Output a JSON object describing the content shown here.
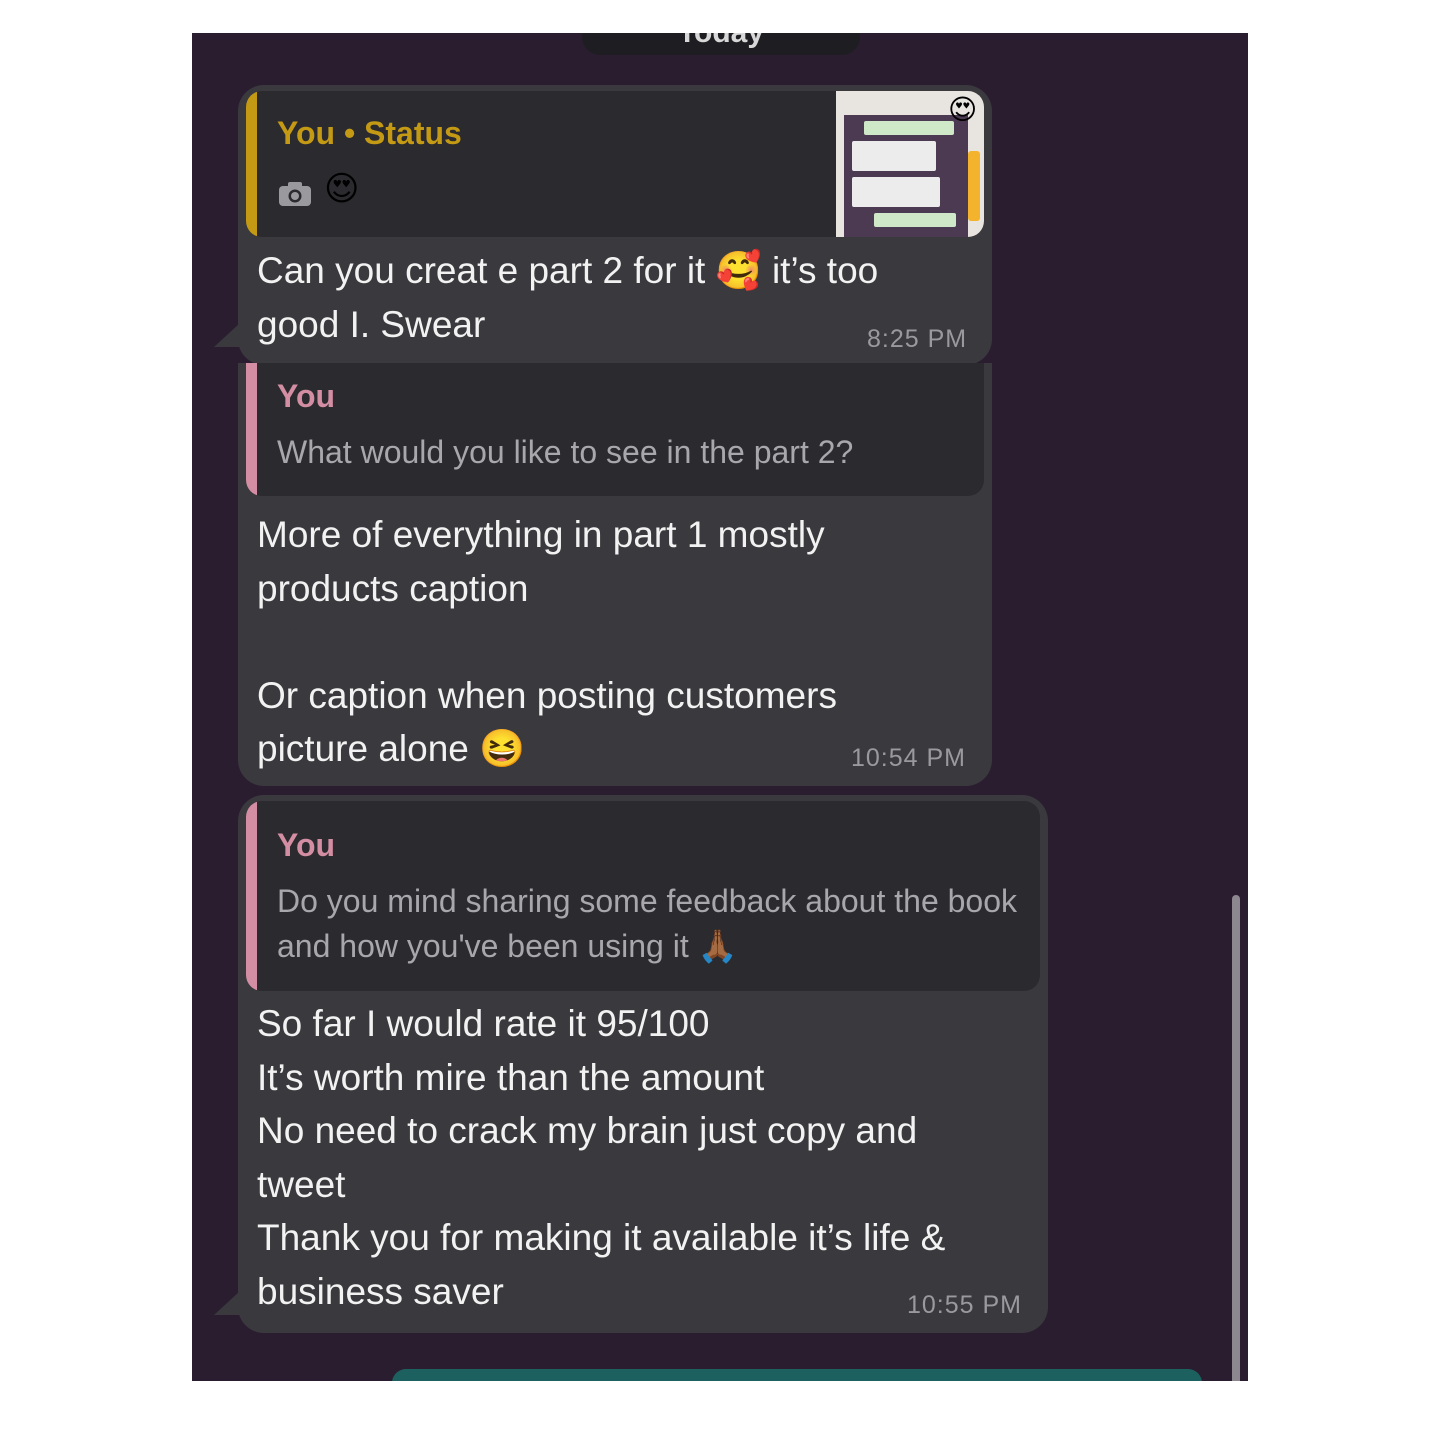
{
  "date_separator": "Today",
  "messages": [
    {
      "quote": {
        "author": "You • Status",
        "icon": "camera-icon",
        "emoji": "😍",
        "thumbnail": "status-thumbnail"
      },
      "text": "Can you creat e part 2 for it 🥰 it’s too good I. Swear",
      "time": "8:25 PM"
    },
    {
      "quote": {
        "author": "You",
        "text": "What would you like to see in the part 2?"
      },
      "text_lines": [
        "More of everything in part 1 mostly",
        "products caption",
        "",
        "Or caption when posting customers",
        "picture alone 😆"
      ],
      "time": "10:54 PM"
    },
    {
      "quote": {
        "author": "You",
        "text": "Do you mind sharing some feedback about the book and how you've been using it 🙏🏾"
      },
      "text_lines": [
        "So far I would rate it 95/100",
        "It’s worth mire than the amount",
        "No need to crack my brain just copy and",
        "tweet",
        "Thank you for making it available it’s life &",
        "business saver"
      ],
      "time": "10:55 PM"
    }
  ],
  "colors": {
    "background": "#2a1d30",
    "bubble": "#3a3a3e",
    "quote_bg": "#2b2b2f",
    "status_accent": "#c49a14",
    "you_accent": "#d48ea3"
  }
}
